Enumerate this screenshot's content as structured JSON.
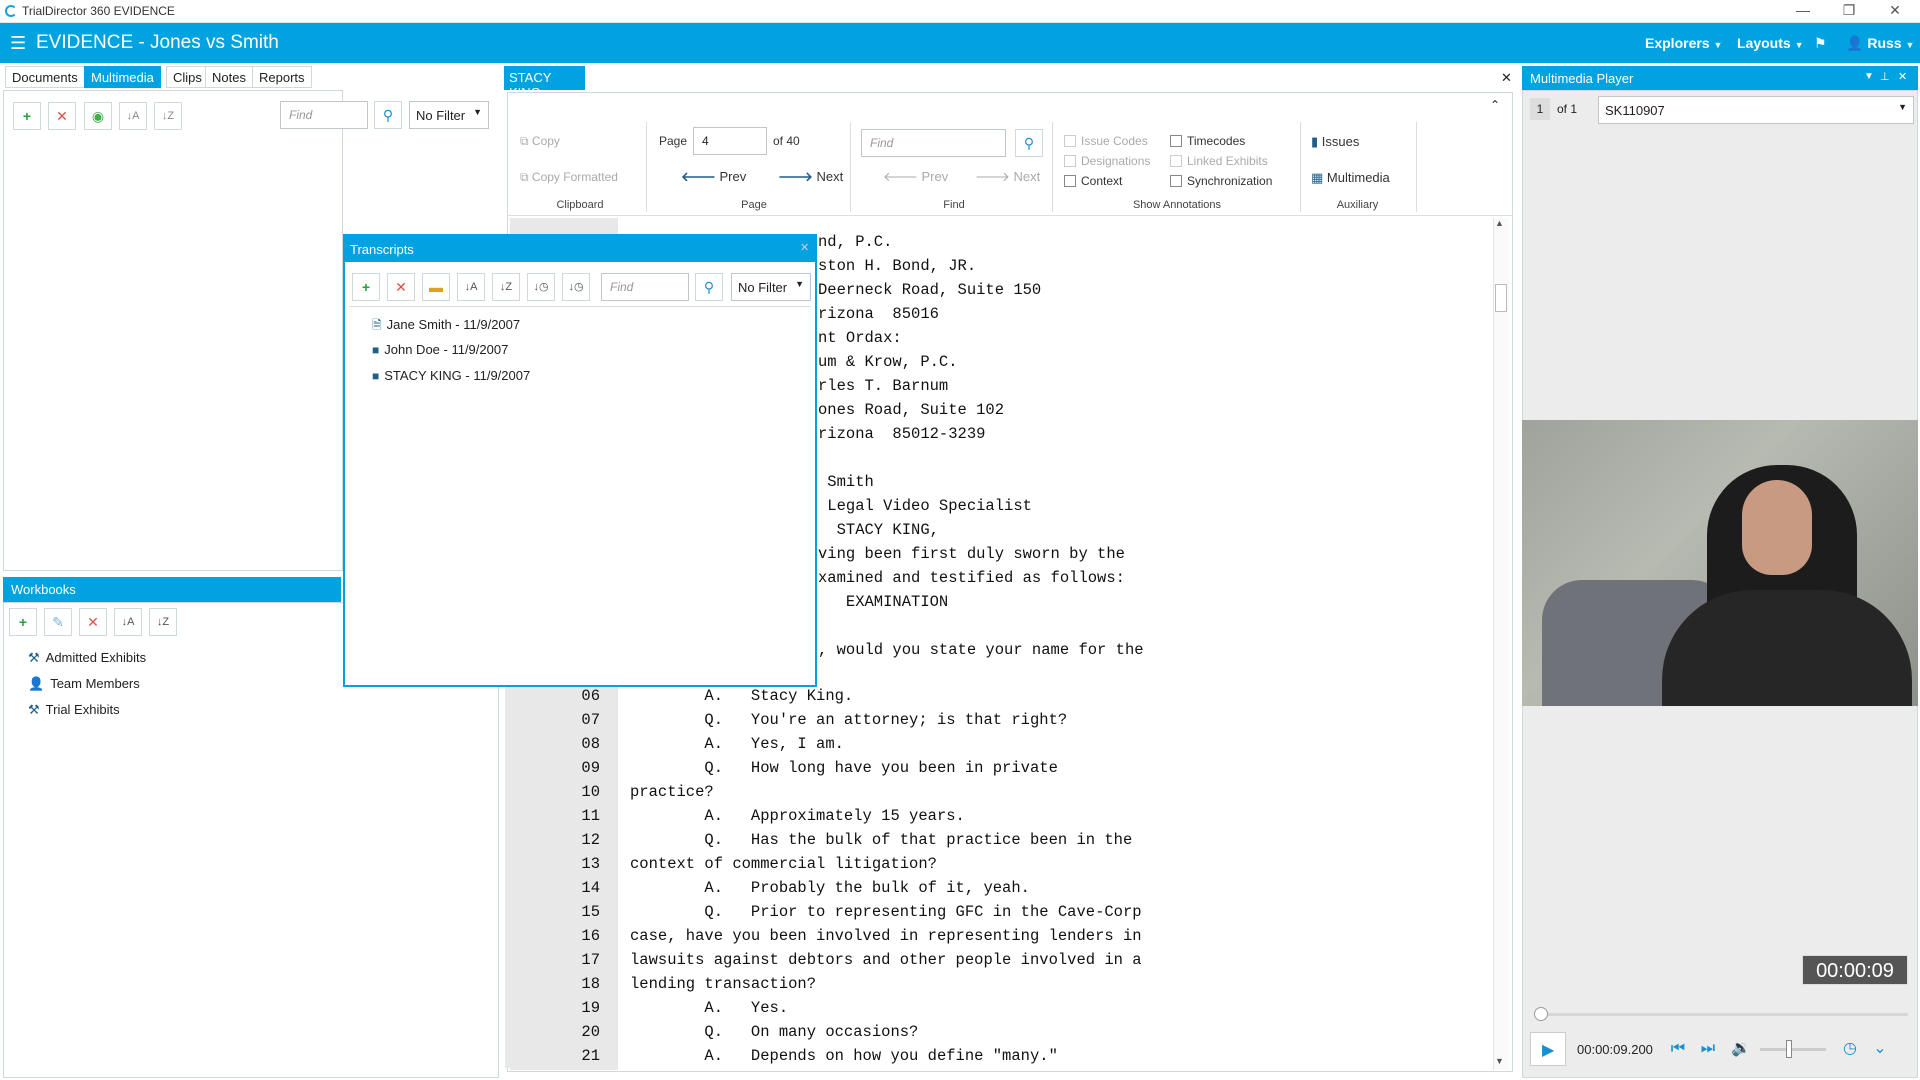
{
  "window": {
    "title": "TrialDirector 360 EVIDENCE",
    "controls": [
      "—",
      "❐",
      "✕"
    ]
  },
  "header": {
    "title": "EVIDENCE - Jones vs Smith",
    "menus": [
      "Explorers",
      "Layouts"
    ],
    "user": "Russ"
  },
  "left": {
    "tabs": [
      "Documents",
      "Multimedia",
      "Clips",
      "Notes",
      "Reports"
    ],
    "find_placeholder": "Find",
    "filter": "No Filter",
    "workbooks": {
      "title": "Workbooks",
      "items": [
        "Admitted Exhibits",
        "Team Members",
        "Trial Exhibits"
      ]
    }
  },
  "transcript_tab": {
    "title": "STACY KING"
  },
  "ribbon": {
    "copy": "Copy",
    "copy_formatted": "Copy Formatted",
    "clipboard": "Clipboard",
    "page_label": "Page",
    "page_value": "4",
    "page_of": "of 40",
    "prev": "Prev",
    "next": "Next",
    "page_group": "Page",
    "find_placeholder": "Find",
    "find_prev": "Prev",
    "find_next": "Next",
    "find_group": "Find",
    "issue_codes": "Issue Codes",
    "designations": "Designations",
    "context": "Context",
    "timecodes": "Timecodes",
    "linked_exhibits": "Linked Exhibits",
    "synchronization": "Synchronization",
    "show_annotations": "Show Annotations",
    "issues": "Issues",
    "multimedia": "Multimedia",
    "auxiliary": "Auxiliary"
  },
  "transcript_upper": [
    "nd, P.C.",
    "ston H. Bond, JR.",
    "Deerneck Road, Suite 150",
    "rizona  85016",
    "nt Ordax:",
    "um & Krow, P.C.",
    "rles T. Barnum",
    "ones Road, Suite 102",
    "rizona  85012-3239",
    "",
    " Smith",
    " Legal Video Specialist",
    "  STACY KING,",
    "ving been first duly sworn by the",
    "xamined and testified as follows:",
    "   EXAMINATION",
    "",
    ", would you state your name for the"
  ],
  "transcript_lines": [
    {
      "n": "06",
      "t": "        A.   Stacy King."
    },
    {
      "n": "07",
      "t": "        Q.   You're an attorney; is that right?"
    },
    {
      "n": "08",
      "t": "        A.   Yes, I am."
    },
    {
      "n": "09",
      "t": "        Q.   How long have you been in private"
    },
    {
      "n": "10",
      "t": "practice?"
    },
    {
      "n": "11",
      "t": "        A.   Approximately 15 years."
    },
    {
      "n": "12",
      "t": "        Q.   Has the bulk of that practice been in the"
    },
    {
      "n": "13",
      "t": "context of commercial litigation?"
    },
    {
      "n": "14",
      "t": "        A.   Probably the bulk of it, yeah."
    },
    {
      "n": "15",
      "t": "        Q.   Prior to representing GFC in the Cave-Corp"
    },
    {
      "n": "16",
      "t": "case, have you been involved in representing lenders in"
    },
    {
      "n": "17",
      "t": "lawsuits against debtors and other people involved in a"
    },
    {
      "n": "18",
      "t": "lending transaction?"
    },
    {
      "n": "19",
      "t": "        A.   Yes."
    },
    {
      "n": "20",
      "t": "        Q.   On many occasions?"
    },
    {
      "n": "21",
      "t": "        A.   Depends on how you define \"many.\""
    }
  ],
  "transcripts_window": {
    "title": "Transcripts",
    "find_placeholder": "Find",
    "filter": "No Filter",
    "items": [
      "Jane Smith - 11/9/2007",
      "John Doe - 11/9/2007",
      "STACY KING - 11/9/2007"
    ]
  },
  "player": {
    "title": "Multimedia Player",
    "index": "1",
    "of": "of 1",
    "clip": "SK110907",
    "overlay_time": "00:00:09",
    "time": "00:00:09.200"
  },
  "colors": {
    "accent": "#00a3e0"
  }
}
